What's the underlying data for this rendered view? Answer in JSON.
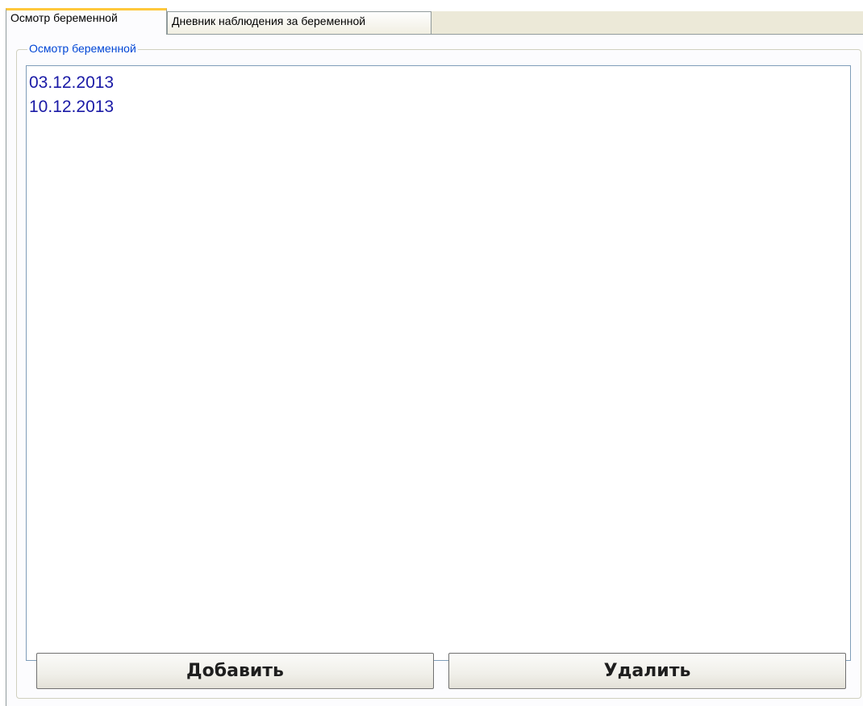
{
  "tabs": [
    {
      "label": "Осмотр беременной",
      "active": true
    },
    {
      "label": "Дневник наблюдения за беременной",
      "active": false
    }
  ],
  "group": {
    "title": "Осмотр беременной"
  },
  "list": {
    "items": [
      "03.12.2013",
      "10.12.2013"
    ]
  },
  "buttons": {
    "add_label": "Добавить",
    "delete_label": "Удалить"
  },
  "colors": {
    "active_tab_accent": "#ffc83c",
    "group_title": "#0046d5",
    "list_text": "#1a1aa6"
  }
}
